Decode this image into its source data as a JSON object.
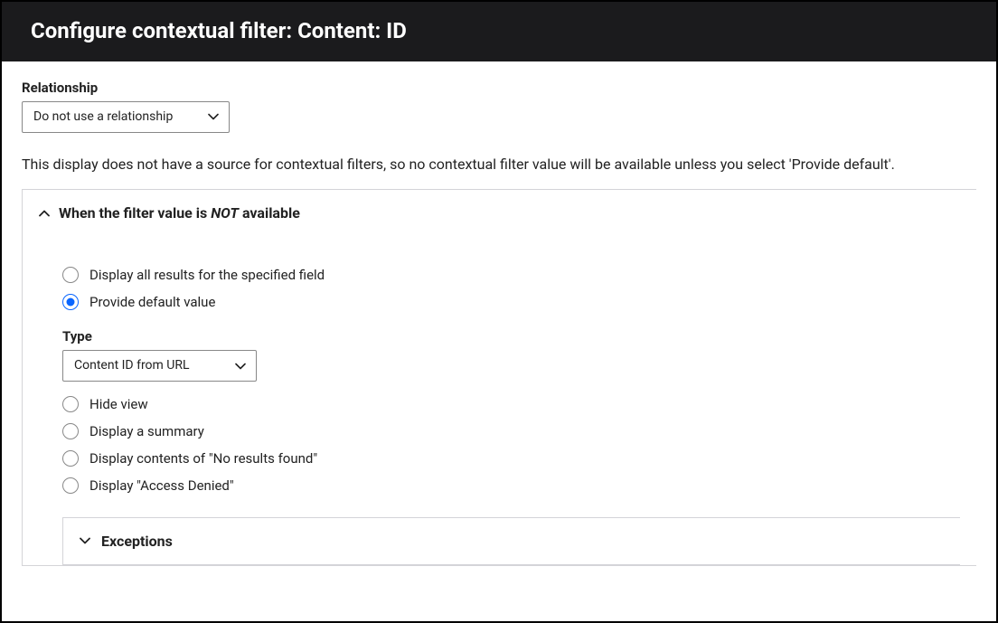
{
  "header": {
    "title": "Configure contextual filter: Content: ID"
  },
  "relationship": {
    "label": "Relationship",
    "selected": "Do not use a relationship"
  },
  "help_text": "This display does not have a source for contextual filters, so no contextual filter value will be available unless you select 'Provide default'.",
  "section_not_available": {
    "title_prefix": "When the filter value is ",
    "title_em": "NOT",
    "title_suffix": " available",
    "options": {
      "display_all": {
        "label": "Display all results for the specified field",
        "checked": false
      },
      "provide_default": {
        "label": "Provide default value",
        "checked": true
      },
      "hide_view": {
        "label": "Hide view",
        "checked": false
      },
      "summary": {
        "label": "Display a summary",
        "checked": false
      },
      "no_results": {
        "label": "Display contents of \"No results found\"",
        "checked": false
      },
      "access_denied": {
        "label": "Display \"Access Denied\"",
        "checked": false
      }
    },
    "type": {
      "label": "Type",
      "selected": "Content ID from URL"
    },
    "exceptions": {
      "title": "Exceptions"
    }
  }
}
